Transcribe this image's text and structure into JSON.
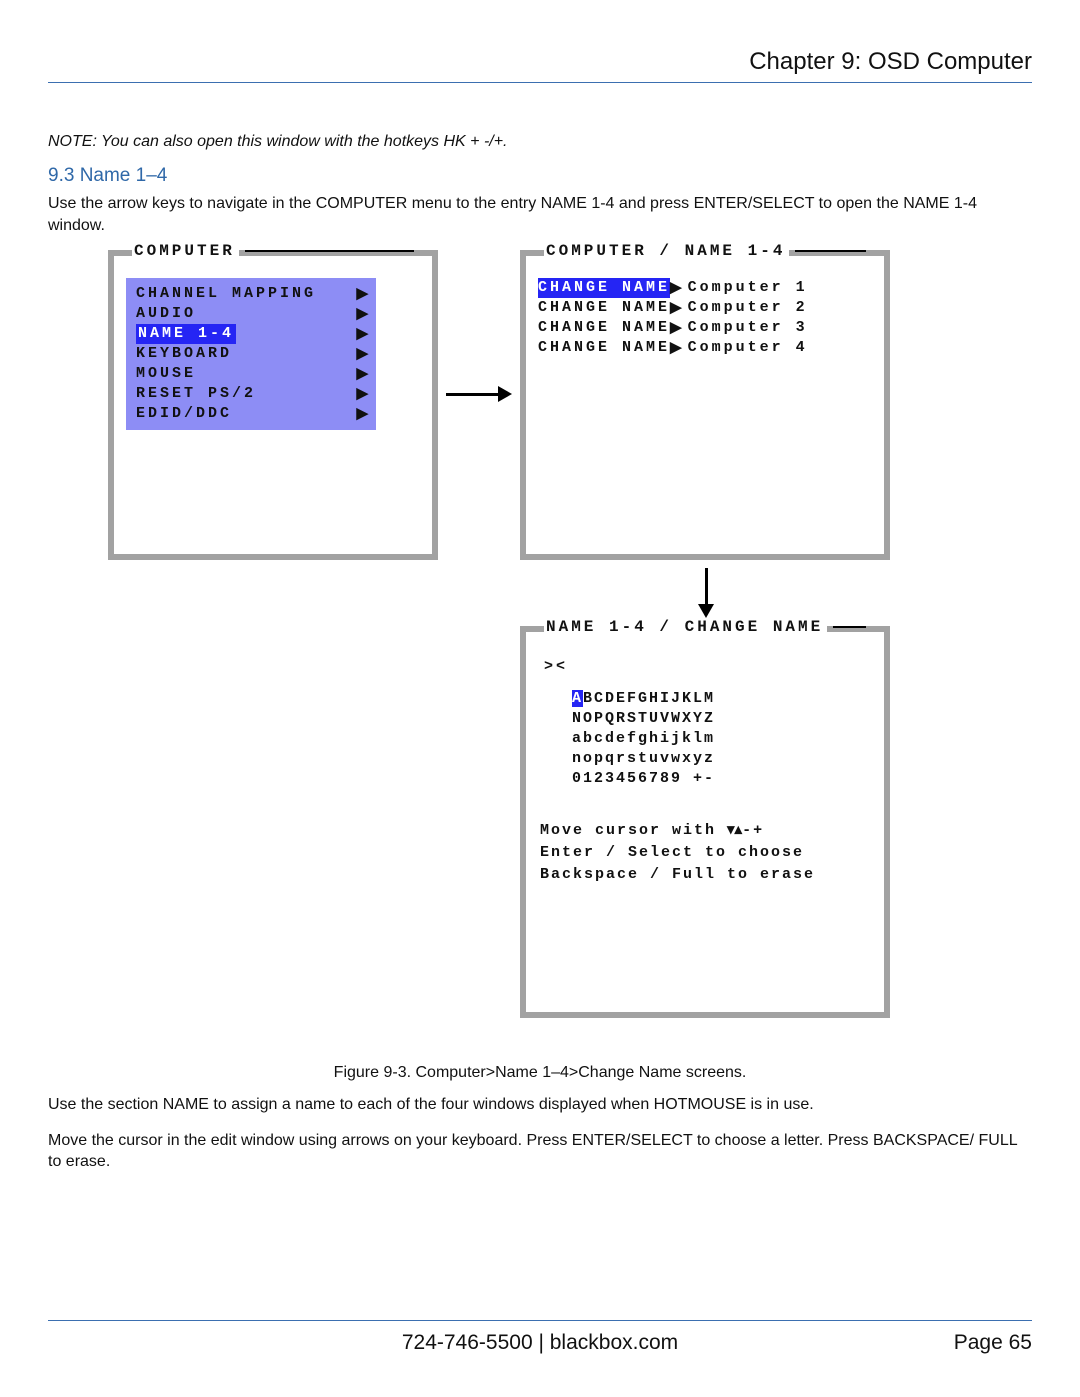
{
  "header": {
    "chapter": "Chapter 9: OSD Computer"
  },
  "note": "NOTE: You can also open this window with the hotkeys HK + -/+.",
  "section": {
    "number_title": "9.3 Name 1–4"
  },
  "intro": "Use the arrow keys to navigate in the COMPUTER menu to the entry NAME 1-4 and press ENTER/SELECT to open the NAME 1-4 window.",
  "osd1": {
    "title": "COMPUTER",
    "items": [
      {
        "label": "CHANNEL MAPPING",
        "selected": false
      },
      {
        "label": "AUDIO",
        "selected": false
      },
      {
        "label": "NAME 1-4",
        "selected": true
      },
      {
        "label": "KEYBOARD",
        "selected": false
      },
      {
        "label": "MOUSE",
        "selected": false
      },
      {
        "label": "RESET PS/2",
        "selected": false
      },
      {
        "label": "EDID/DDC",
        "selected": false
      }
    ]
  },
  "osd2": {
    "title": "COMPUTER / NAME 1-4",
    "rows": [
      {
        "action": "CHANGE NAME",
        "value": "Computer 1",
        "selected": true
      },
      {
        "action": "CHANGE NAME",
        "value": "Computer 2",
        "selected": false
      },
      {
        "action": "CHANGE NAME",
        "value": "Computer 3",
        "selected": false
      },
      {
        "action": "CHANGE NAME",
        "value": "Computer 4",
        "selected": false
      }
    ]
  },
  "osd3": {
    "title": "NAME 1-4 / CHANGE NAME",
    "cursor": "><",
    "chars": {
      "row1_first": "A",
      "row1_rest": "BCDEFGHIJKLM",
      "row2": "NOPQRSTUVWXYZ",
      "row3": "abcdefghijklm",
      "row4": "nopqrstuvwxyz",
      "row5": "0123456789 +-"
    },
    "instructions": {
      "l1a": "Move cursor with ",
      "l1b": "▾▴",
      "l1c": "-+",
      "l2": "Enter / Select to choose",
      "l3": "Backspace / Full to erase"
    }
  },
  "caption": "Figure 9-3. Computer>Name 1–4>Change Name screens.",
  "para1": "Use the section NAME to assign a name to each of the four windows displayed when HOTMOUSE is in use.",
  "para2": "Move the cursor in the edit window using arrows on your keyboard. Press ENTER/SELECT to choose a letter. Press BACKSPACE/ FULL to erase.",
  "footer": {
    "center": "724-746-5500   |   blackbox.com",
    "page": "Page 65"
  }
}
